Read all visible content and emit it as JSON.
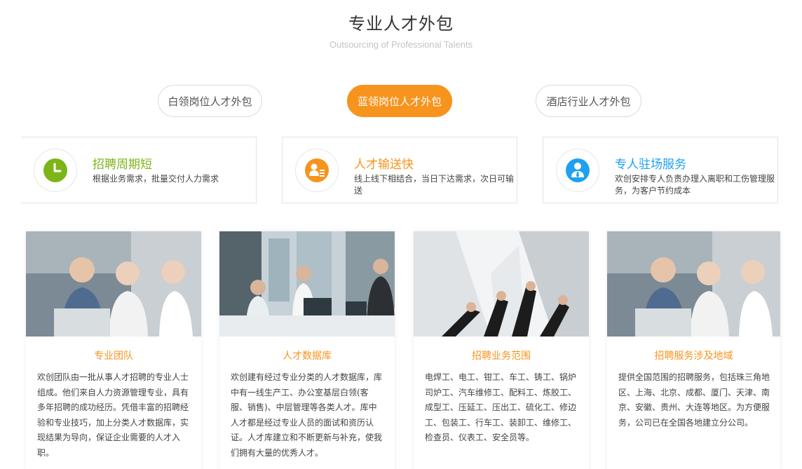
{
  "header": {
    "title": "专业人才外包",
    "subtitle": "Outsourcing of Professional Talents"
  },
  "tabs": [
    {
      "label": "白领岗位人才外包",
      "active": false
    },
    {
      "label": "蓝领岗位人才外包",
      "active": true
    },
    {
      "label": "酒店行业人才外包",
      "active": false
    }
  ],
  "features": [
    {
      "title": "招聘周期短",
      "desc": "根据业务需求，批量交付人力需求",
      "icon": "clock-icon",
      "color": "#7cb518"
    },
    {
      "title": "人才输送快",
      "desc": "线上线下相结合，当日下达需求，次日可输送",
      "icon": "person-list-icon",
      "color": "#f7941d"
    },
    {
      "title": "专人驻场服务",
      "desc": "欢创安排专人负责办理入离职和工伤管理服务，为客户节约成本",
      "icon": "staff-icon",
      "color": "#1da1f2"
    }
  ],
  "cards": [
    {
      "title": "专业团队",
      "desc": "欢创团队由一批从事人才招聘的专业人士组成。他们来自人力资源管理专业，具有多年招聘的成功经历。凭借丰富的招聘经验和专业技巧，加上分类人才数据库，实现结果为导向，保证企业需要的人才入职。",
      "image": "business-team-photo"
    },
    {
      "title": "人才数据库",
      "desc": "欢创建有经过专业分类的人才数据库，库中有一线生产工、办公室基层白领(客服、销售)、中层管理等各类人才。库中人才都是经过专业人员的面试和资历认证。人才库建立和不断更新与补充，使我们拥有大量的优秀人才。",
      "image": "office-workers-photo"
    },
    {
      "title": "招聘业务范围",
      "desc": "电焊工、电工、钳工、车工、铸工、锅炉司炉工、汽车维修工、配料工、炼胶工、成型工、压延工、压出工、硫化工、修边工、包装工、行车工、装卸工、维修工、检查员、仪表工、安全员等。",
      "image": "raised-fists-photo"
    },
    {
      "title": "招聘服务涉及地域",
      "desc": "提供全国范围的招聘服务，包括珠三角地区、上海、北京、成都、厦门、天津、南京、安徽、贵州、大连等地区。为方便服务，公司已在全国各地建立分公司。",
      "image": "business-team-photo"
    }
  ],
  "colors": {
    "accent": "#f7941d",
    "green": "#7cb518",
    "blue": "#1da1f2"
  }
}
